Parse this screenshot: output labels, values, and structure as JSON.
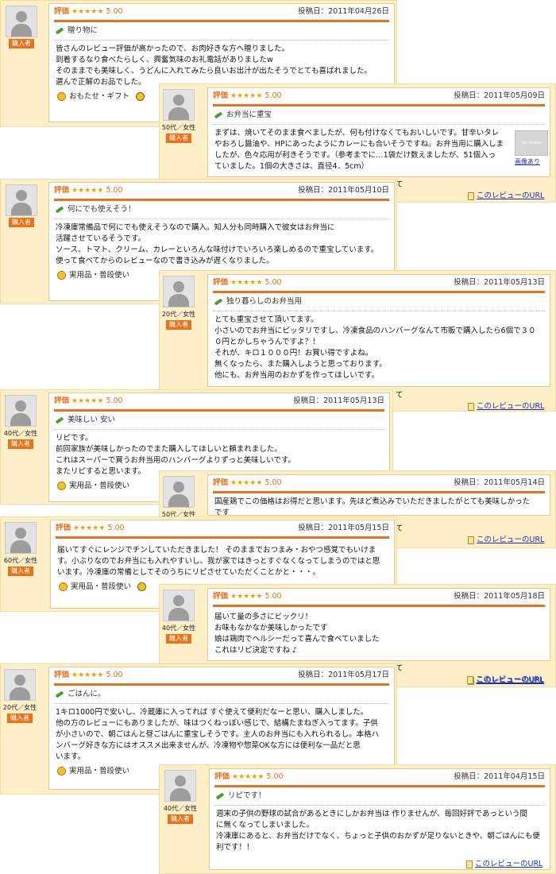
{
  "reviews": [
    {
      "rating_label": "評価",
      "stars": "★★★★★",
      "score": "5.00",
      "date": "投稿日：2011年04月26日",
      "demographic": "",
      "badge": "購入者",
      "title": "贈り物に",
      "body": [
        "皆さんのレビュー評価が高かったので、お肉好きな方へ贈りました。",
        "到着するなり食べたらしく、興奮気味のお礼電話がありましたw",
        "そのままでも美味しく、うどんに入れてみたら良いお出汁が出たそうでとても喜ばれました。",
        "選んで正解のお品でした。"
      ],
      "tags": [
        "おもたせ・ギフト"
      ],
      "link": ""
    },
    {
      "rating_label": "評価",
      "stars": "★★★★★",
      "score": "5.00",
      "date": "投稿日：2011年05月09日",
      "demographic": "50代／女性",
      "badge": "購入者",
      "title": "お弁当に重宝",
      "body": [
        "まずは、焼いてそのまま食べましたが、何も付けなくてもおいしいです。甘辛いタレ",
        "やおろし醤油や、HPにあったようにカレーにも合いそうですね。お弁当用に購入しま",
        "したが、色々応用が利きそうです。（参考までに…1袋だけ数えましたが、51個入っ",
        "ていました。1個の大きさは、直径4．5cm）"
      ],
      "tags": [],
      "link": "このレビューのURL",
      "noimage_text": "No Image",
      "noimage_link": "画像あり",
      "tail": "て"
    },
    {
      "rating_label": "評価",
      "stars": "★★★★★",
      "score": "5.00",
      "date": "投稿日：2011年05月10日",
      "demographic": "",
      "badge": "購入者",
      "title": "何にでも使えそう！",
      "body": [
        "冷凍庫常備品で何にでも使えそうなので購入。知人分も同時購入で彼女はお弁当に",
        "活躍させているそうです。",
        "ソース、トマト、クリーム、カレーといろんな味付けでいろいろ楽しめるので重宝しています。",
        "使って食べてからのレビューなので書き込みが遅くなりました。"
      ],
      "tags": [
        "実用品・普段使い"
      ],
      "link": ""
    },
    {
      "rating_label": "評価",
      "stars": "★★★★★",
      "score": "5.00",
      "date": "投稿日：2011年05月13日",
      "demographic": "20代／女性",
      "badge": "購入者",
      "title": "独り暮らしのお弁当用",
      "body": [
        "とても重宝させて頂いてます。",
        "小さいのでお弁当にピッタリですし、冷凍食品のハンバーグなんて市販で購入したら6個で３０",
        "０円とかしちゃうんですよ？！",
        "それが、キロ１０００円！お買い得ですよね。",
        "無くなったら、また購入しようと思っております。",
        "他にも、お弁当用のおかずを作ってほしいです。"
      ],
      "tags": [],
      "link": "このレビューのURL",
      "tail": "て"
    },
    {
      "rating_label": "評価",
      "stars": "★★★★★",
      "score": "5.00",
      "date": "投稿日：2011年05月13日",
      "demographic": "40代／女性",
      "badge": "購入者",
      "title": "美味しい 安い",
      "body": [
        "リピです。",
        "前回家族が美味しかったのでまた購入してほしいと頼まれました。",
        "これはスーパーで買うお弁当用のハンバーグよりずっと美味しいです。",
        "またリピすると思います。"
      ],
      "tags": [
        "実用品・普段使い"
      ],
      "link": ""
    },
    {
      "rating_label": "評価",
      "stars": "★★★★★",
      "score": "5.00",
      "date": "投稿日：2011年05月14日",
      "demographic": "50代／女性",
      "badge": "",
      "title": "",
      "body": [
        "国産鶏でこの価格はお得だと思います。先ほど煮込みでいただきましたがとても美味しかった",
        "です"
      ],
      "tags": [],
      "link": "このレビューのURL",
      "tail": "て"
    },
    {
      "rating_label": "評価",
      "stars": "★★★★★",
      "score": "5.00",
      "date": "投稿日：2011年05月15日",
      "demographic": "60代／女性",
      "badge": "購入者",
      "title": "",
      "body": [
        "届いてすぐにレンジでチンしていただきました！ そのままでおつまみ・おやつ感覚でもいけま",
        "す。小ぶりなのでお弁当にも入れやすいし、我が家ではきっとすぐなくなってしまうのではと思",
        "います。冷凍庫の常備としてそのうちにリピさせていただくことかと・・・。"
      ],
      "tags": [
        "実用品・普段使い"
      ],
      "link": ""
    },
    {
      "rating_label": "評価",
      "stars": "★★★★★",
      "score": "5.00",
      "date": "投稿日：2011年05月18日",
      "demographic": "40代／女性",
      "badge": "購入者",
      "title": "",
      "body": [
        "届いて量の多さにビックリ！",
        "お味もなかなか美味しかったです",
        "娘は鶏肉でヘルシーだって喜んで食べていました",
        "これはリピ決定ですね ♪"
      ],
      "tags": [],
      "link": "このレビューのURL",
      "tail": "て"
    },
    {
      "rating_label": "評価",
      "stars": "★★★★★",
      "score": "5.00",
      "date": "投稿日：2011年05月17日",
      "demographic": "20代／女性",
      "badge": "購入者",
      "title": "ごはんに。",
      "body": [
        "1キロ1000円で安いし、冷蔵庫に入ってれば すぐ使えて便利だなーと思い、購入しました。",
        "他の方のレビューにもありましたが、味はつくねっぽい感じで、結構たまねぎ入ってます。子供",
        "が小さいので、朝ごはんと昼ごはんに重宝しそうです。主人のお弁当にも入れられるし。本格ハ",
        "ンバーグ好きな方にはオススメ出来ませんが、冷凍物や惣菜OKな方には便利な一品だと思",
        "います。"
      ],
      "tags": [
        "実用品・普段使い"
      ],
      "link": "このレビューのURL"
    },
    {
      "rating_label": "評価",
      "stars": "★★★★★",
      "score": "5.00",
      "date": "投稿日：2011年04月15日",
      "demographic": "40代／女性",
      "badge": "購入者",
      "title": "リピです！",
      "body": [
        "週末の子供の野球の試合があるときにしかお弁当は 作りませんが、毎回好評であっという間",
        "に無くなってしまいました。",
        "冷凍庫にあると、お弁当だけでなく、ちょっと子供のおかずが足りないときや、朝ごはんにも便",
        "利です！！"
      ],
      "tags": [],
      "link": "このレビューのURL"
    }
  ]
}
